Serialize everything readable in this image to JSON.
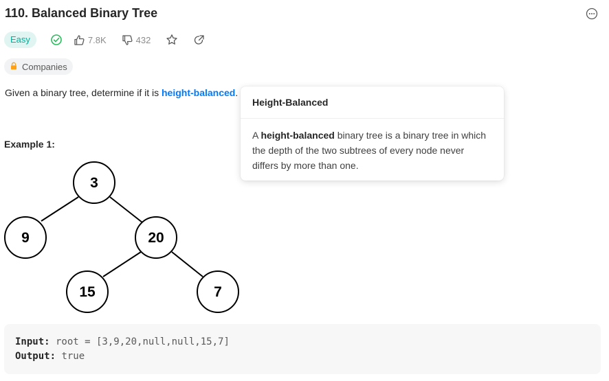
{
  "problem": {
    "title": "110. Balanced Binary Tree",
    "difficulty": "Easy",
    "likes": "7.8K",
    "dislikes": "432",
    "companies_label": "Companies",
    "description_prefix": "Given a binary tree, determine if it is ",
    "description_link": "height-balanced",
    "description_suffix": "."
  },
  "icons": {
    "solved": "check-circle-icon",
    "like": "thumbs-up-icon",
    "dislike": "thumbs-down-icon",
    "favorite": "star-icon",
    "share": "share-icon",
    "more": "more-icon",
    "lock": "lock-icon"
  },
  "colors": {
    "easy_text": "#00af9b",
    "easy_bg": "#e0f5f1",
    "link": "#007aff",
    "lock": "#ffa116"
  },
  "popover": {
    "title": "Height-Balanced",
    "body_prefix": "A ",
    "body_bold": "height-balanced",
    "body_suffix": " binary tree is a binary tree in which the depth of the two subtrees of every node never differs by more than one."
  },
  "example": {
    "title": "Example 1:",
    "tree_nodes": [
      "3",
      "9",
      "20",
      "15",
      "7"
    ],
    "input_label": "Input:",
    "input_value": " root = [3,9,20,null,null,15,7]",
    "output_label": "Output:",
    "output_value": " true"
  }
}
